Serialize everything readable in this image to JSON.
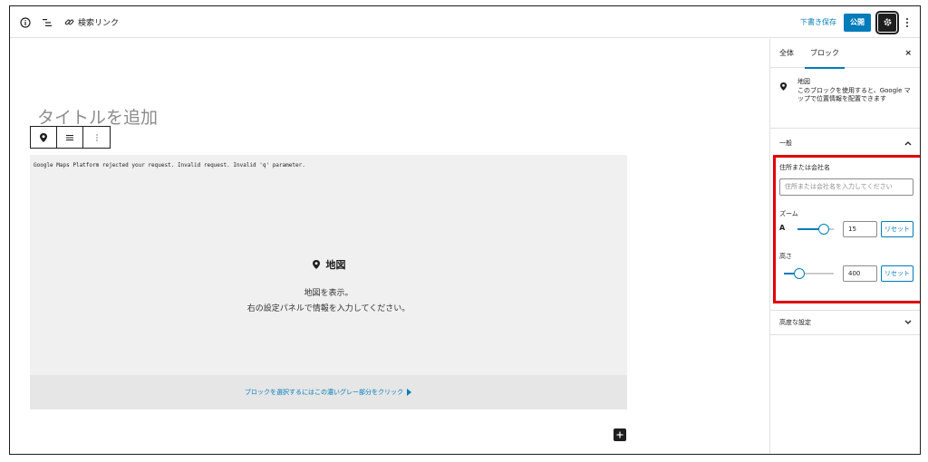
{
  "toolbar": {
    "search_link_label": "検索リンク",
    "save_draft_label": "下書き保存",
    "publish_label": "公開"
  },
  "editor": {
    "title_placeholder": "タイトルを追加",
    "map_error": "Google Maps Platform rejected your request. Invalid request. Invalid 'q' parameter.",
    "map_heading": "地図",
    "map_desc_line1": "地図を表示。",
    "map_desc_line2": "右の設定パネルで情報を入力してください。",
    "map_footer": "ブロックを選択するにはこの濃いグレー部分をクリック"
  },
  "sidebar": {
    "tab_document": "全体",
    "tab_block": "ブロック",
    "close_label": "×",
    "block_title": "地図",
    "block_description": "このブロックを使用すると、Google マップで位置情報を配置できます",
    "general_label": "一般",
    "address_label": "住所または会社名",
    "address_placeholder": "住所または会社名を入力してください",
    "zoom_label": "ズーム",
    "zoom_icon_text": "A",
    "zoom_value": "15",
    "zoom_fraction": 0.72,
    "height_label": "高さ",
    "height_value": "400",
    "height_fraction": 0.3,
    "reset_label": "リセット",
    "advanced_label": "高度な設定"
  },
  "colors": {
    "accent": "#007cba",
    "highlight": "#e00000"
  }
}
